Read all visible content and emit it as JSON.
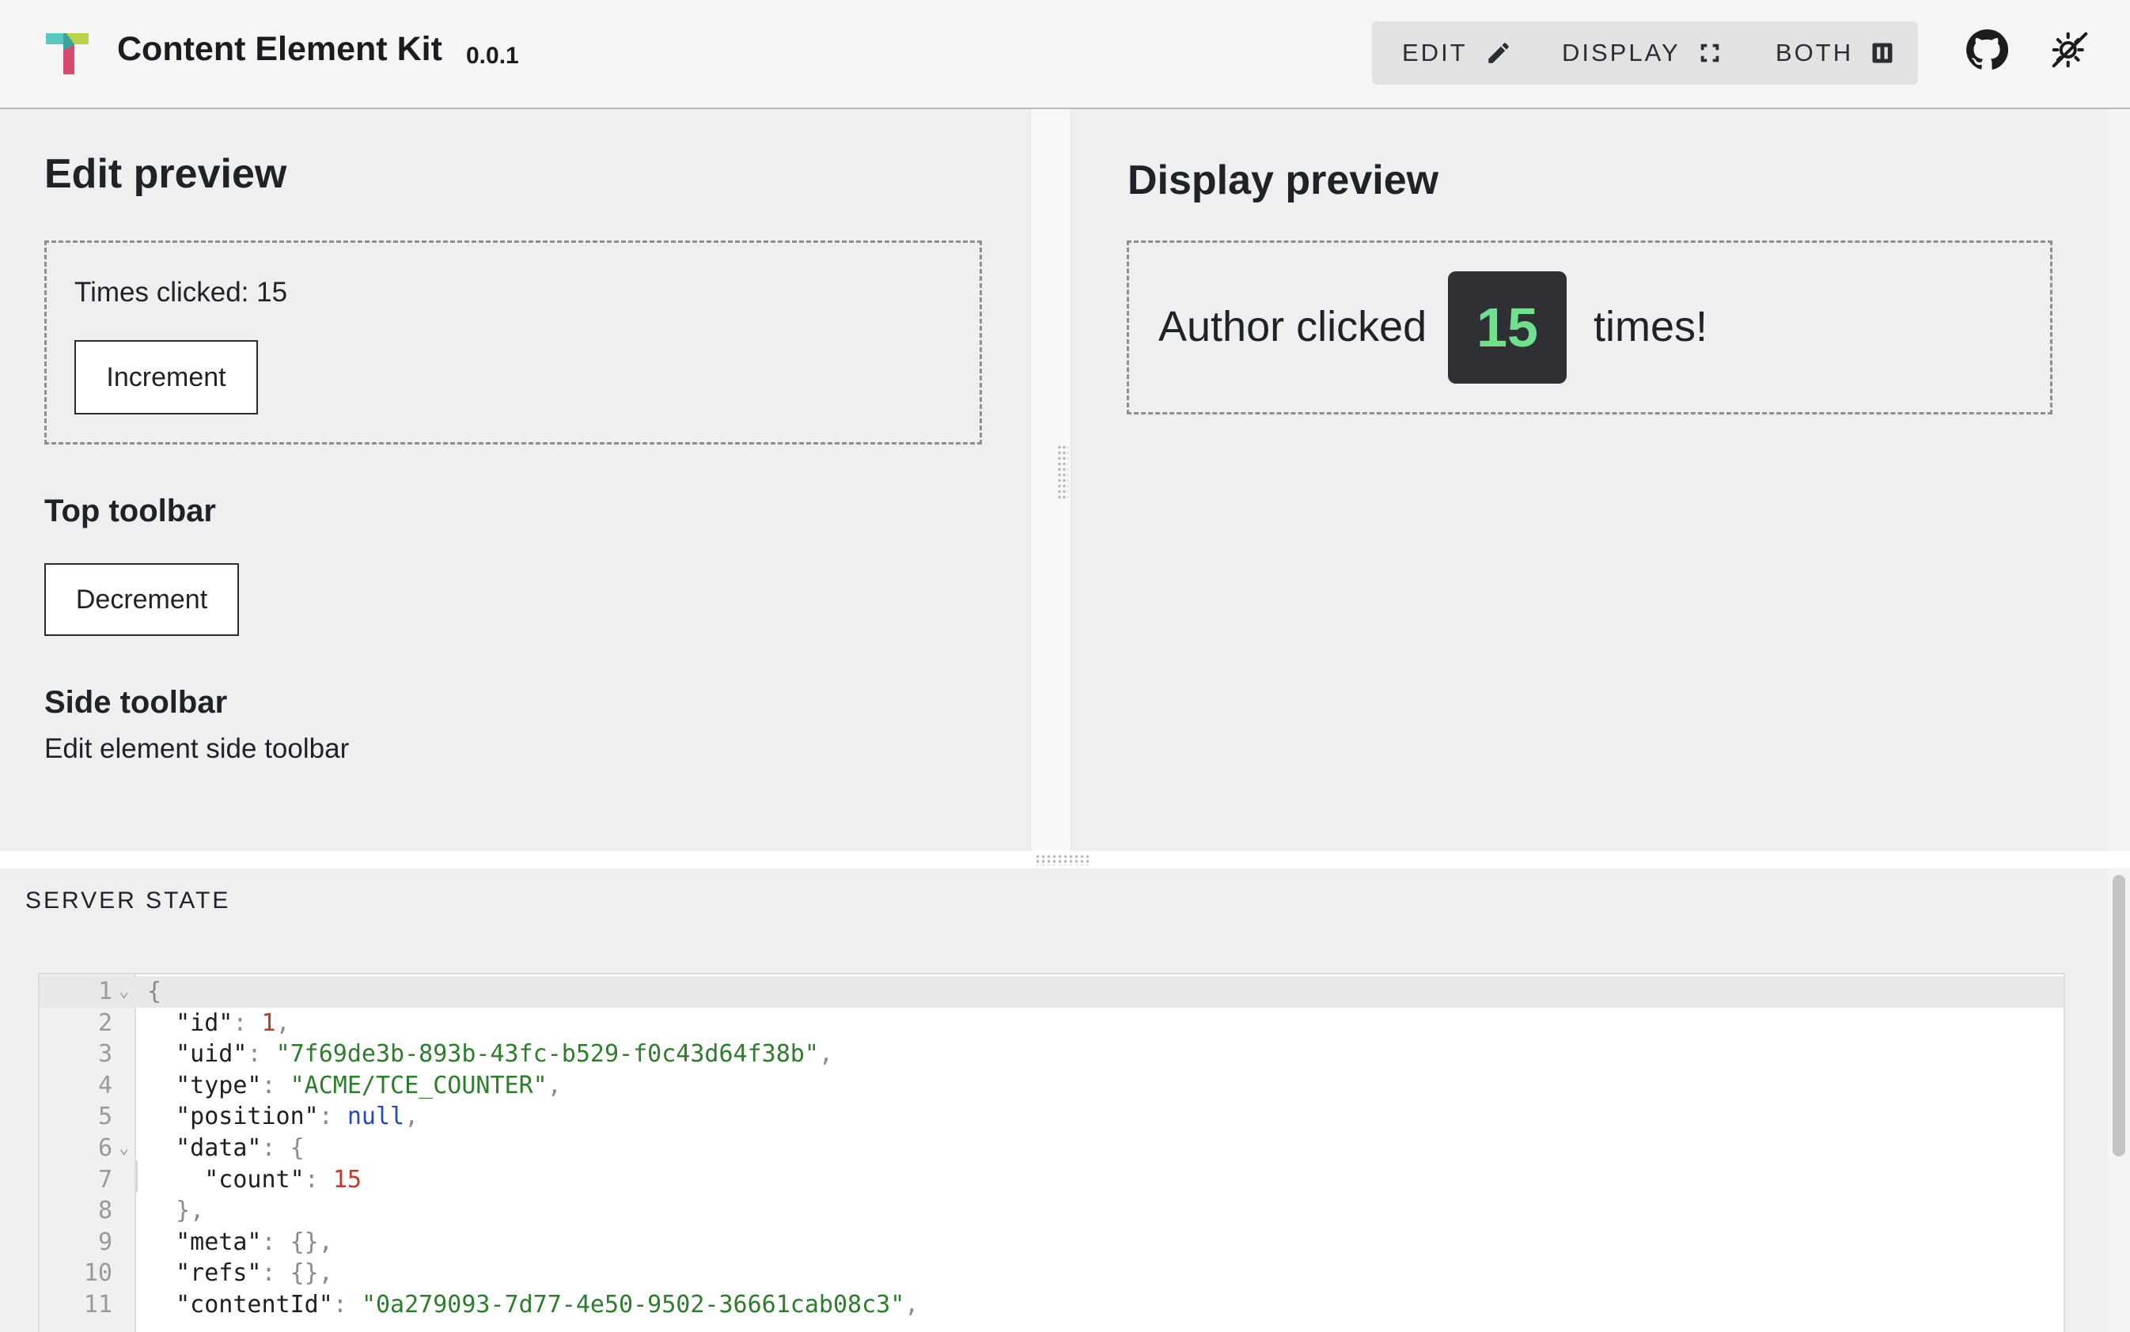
{
  "header": {
    "title": "Content Element Kit",
    "version": "0.0.1",
    "modes": [
      {
        "label": "EDIT",
        "icon": "pencil-icon"
      },
      {
        "label": "DISPLAY",
        "icon": "fullscreen-icon"
      },
      {
        "label": "BOTH",
        "icon": "split-view-icon"
      }
    ],
    "github_icon": "github-icon",
    "theme_icon": "theme-toggle-icon"
  },
  "edit_preview": {
    "title": "Edit preview",
    "times_clicked_text": "Times clicked: 15",
    "increment_label": "Increment",
    "top_toolbar_title": "Top toolbar",
    "decrement_label": "Decrement",
    "side_toolbar_title": "Side toolbar",
    "side_toolbar_text": "Edit element side toolbar"
  },
  "display_preview": {
    "title": "Display preview",
    "prefix": "Author clicked",
    "count": "15",
    "suffix": "times!"
  },
  "server_state": {
    "label": "SERVER STATE",
    "lines": [
      {
        "n": "1",
        "fold": true,
        "parts": [
          {
            "t": "{",
            "c": "p"
          }
        ]
      },
      {
        "n": "2",
        "fold": false,
        "parts": [
          {
            "t": "  \"id\"",
            "c": "k"
          },
          {
            "t": ": ",
            "c": "p"
          },
          {
            "t": "1",
            "c": "n"
          },
          {
            "t": ",",
            "c": "p"
          }
        ]
      },
      {
        "n": "3",
        "fold": false,
        "parts": [
          {
            "t": "  \"uid\"",
            "c": "k"
          },
          {
            "t": ": ",
            "c": "p"
          },
          {
            "t": "\"7f69de3b-893b-43fc-b529-f0c43d64f38b\"",
            "c": "s"
          },
          {
            "t": ",",
            "c": "p"
          }
        ]
      },
      {
        "n": "4",
        "fold": false,
        "parts": [
          {
            "t": "  \"type\"",
            "c": "k"
          },
          {
            "t": ": ",
            "c": "p"
          },
          {
            "t": "\"ACME/TCE_COUNTER\"",
            "c": "s"
          },
          {
            "t": ",",
            "c": "p"
          }
        ]
      },
      {
        "n": "5",
        "fold": false,
        "parts": [
          {
            "t": "  \"position\"",
            "c": "k"
          },
          {
            "t": ": ",
            "c": "p"
          },
          {
            "t": "null",
            "c": "nl"
          },
          {
            "t": ",",
            "c": "p"
          }
        ]
      },
      {
        "n": "6",
        "fold": true,
        "parts": [
          {
            "t": "  \"data\"",
            "c": "k"
          },
          {
            "t": ": {",
            "c": "p"
          }
        ]
      },
      {
        "n": "7",
        "fold": false,
        "parts": [
          {
            "t": "    \"count\"",
            "c": "k"
          },
          {
            "t": ": ",
            "c": "p"
          },
          {
            "t": "15",
            "c": "n"
          }
        ]
      },
      {
        "n": "8",
        "fold": false,
        "parts": [
          {
            "t": "  },",
            "c": "p"
          }
        ]
      },
      {
        "n": "9",
        "fold": false,
        "parts": [
          {
            "t": "  \"meta\"",
            "c": "k"
          },
          {
            "t": ": {},",
            "c": "p"
          }
        ]
      },
      {
        "n": "10",
        "fold": false,
        "parts": [
          {
            "t": "  \"refs\"",
            "c": "k"
          },
          {
            "t": ": {},",
            "c": "p"
          }
        ]
      },
      {
        "n": "11",
        "fold": false,
        "parts": [
          {
            "t": "  \"contentId\"",
            "c": "k"
          },
          {
            "t": ": ",
            "c": "p"
          },
          {
            "t": "\"0a279093-7d77-4e50-9502-36661cab08c3\"",
            "c": "s"
          },
          {
            "t": ",",
            "c": "p"
          }
        ]
      }
    ]
  }
}
